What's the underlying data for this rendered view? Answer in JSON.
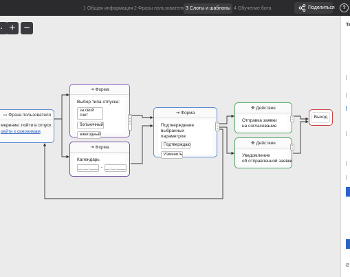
{
  "tabs": [
    {
      "num": "1",
      "label": "Общая информация",
      "active": false
    },
    {
      "num": "2",
      "label": "Фразы пользователя",
      "active": false
    },
    {
      "num": "3",
      "label": "Слоты и шаблоны",
      "active": true
    },
    {
      "num": "4",
      "label": "Обучение бота",
      "active": false
    }
  ],
  "share_label": "Поделиться",
  "panel_title": "Te",
  "nodes": {
    "phrase": {
      "title": "Фраза пользователя",
      "line1": "мерение: пойти в отпуск",
      "link": "рейти к синонимам"
    },
    "form_type": {
      "title": "Форма",
      "heading": "Выбор типа отпуска:",
      "options": [
        "за свой счет",
        "больничный",
        "ежегодный"
      ]
    },
    "form_calendar": {
      "title": "Форма",
      "heading": "Календарь",
      "date_from": "__.__.____",
      "separator": "-",
      "date_to": "__.__.____"
    },
    "confirm": {
      "title": "Форма",
      "heading_line1": "Подтверждение",
      "heading_line2": "выбранных параметров",
      "buttons": [
        "Подтверждаю",
        "Изменить"
      ]
    },
    "action_send": {
      "title": "Действие",
      "line1": "Отправка заявки",
      "line2": "на согласование"
    },
    "action_notify": {
      "title": "Действие",
      "line1": "Уведомление",
      "line2": "об отправленной заявки"
    },
    "exit": {
      "label": "Выход"
    }
  },
  "colors": {
    "form": "#8a5db8",
    "confirm": "#5c8ad6",
    "action": "#4aa35a",
    "exit": "#c94545",
    "accent": "#2d63c8"
  }
}
